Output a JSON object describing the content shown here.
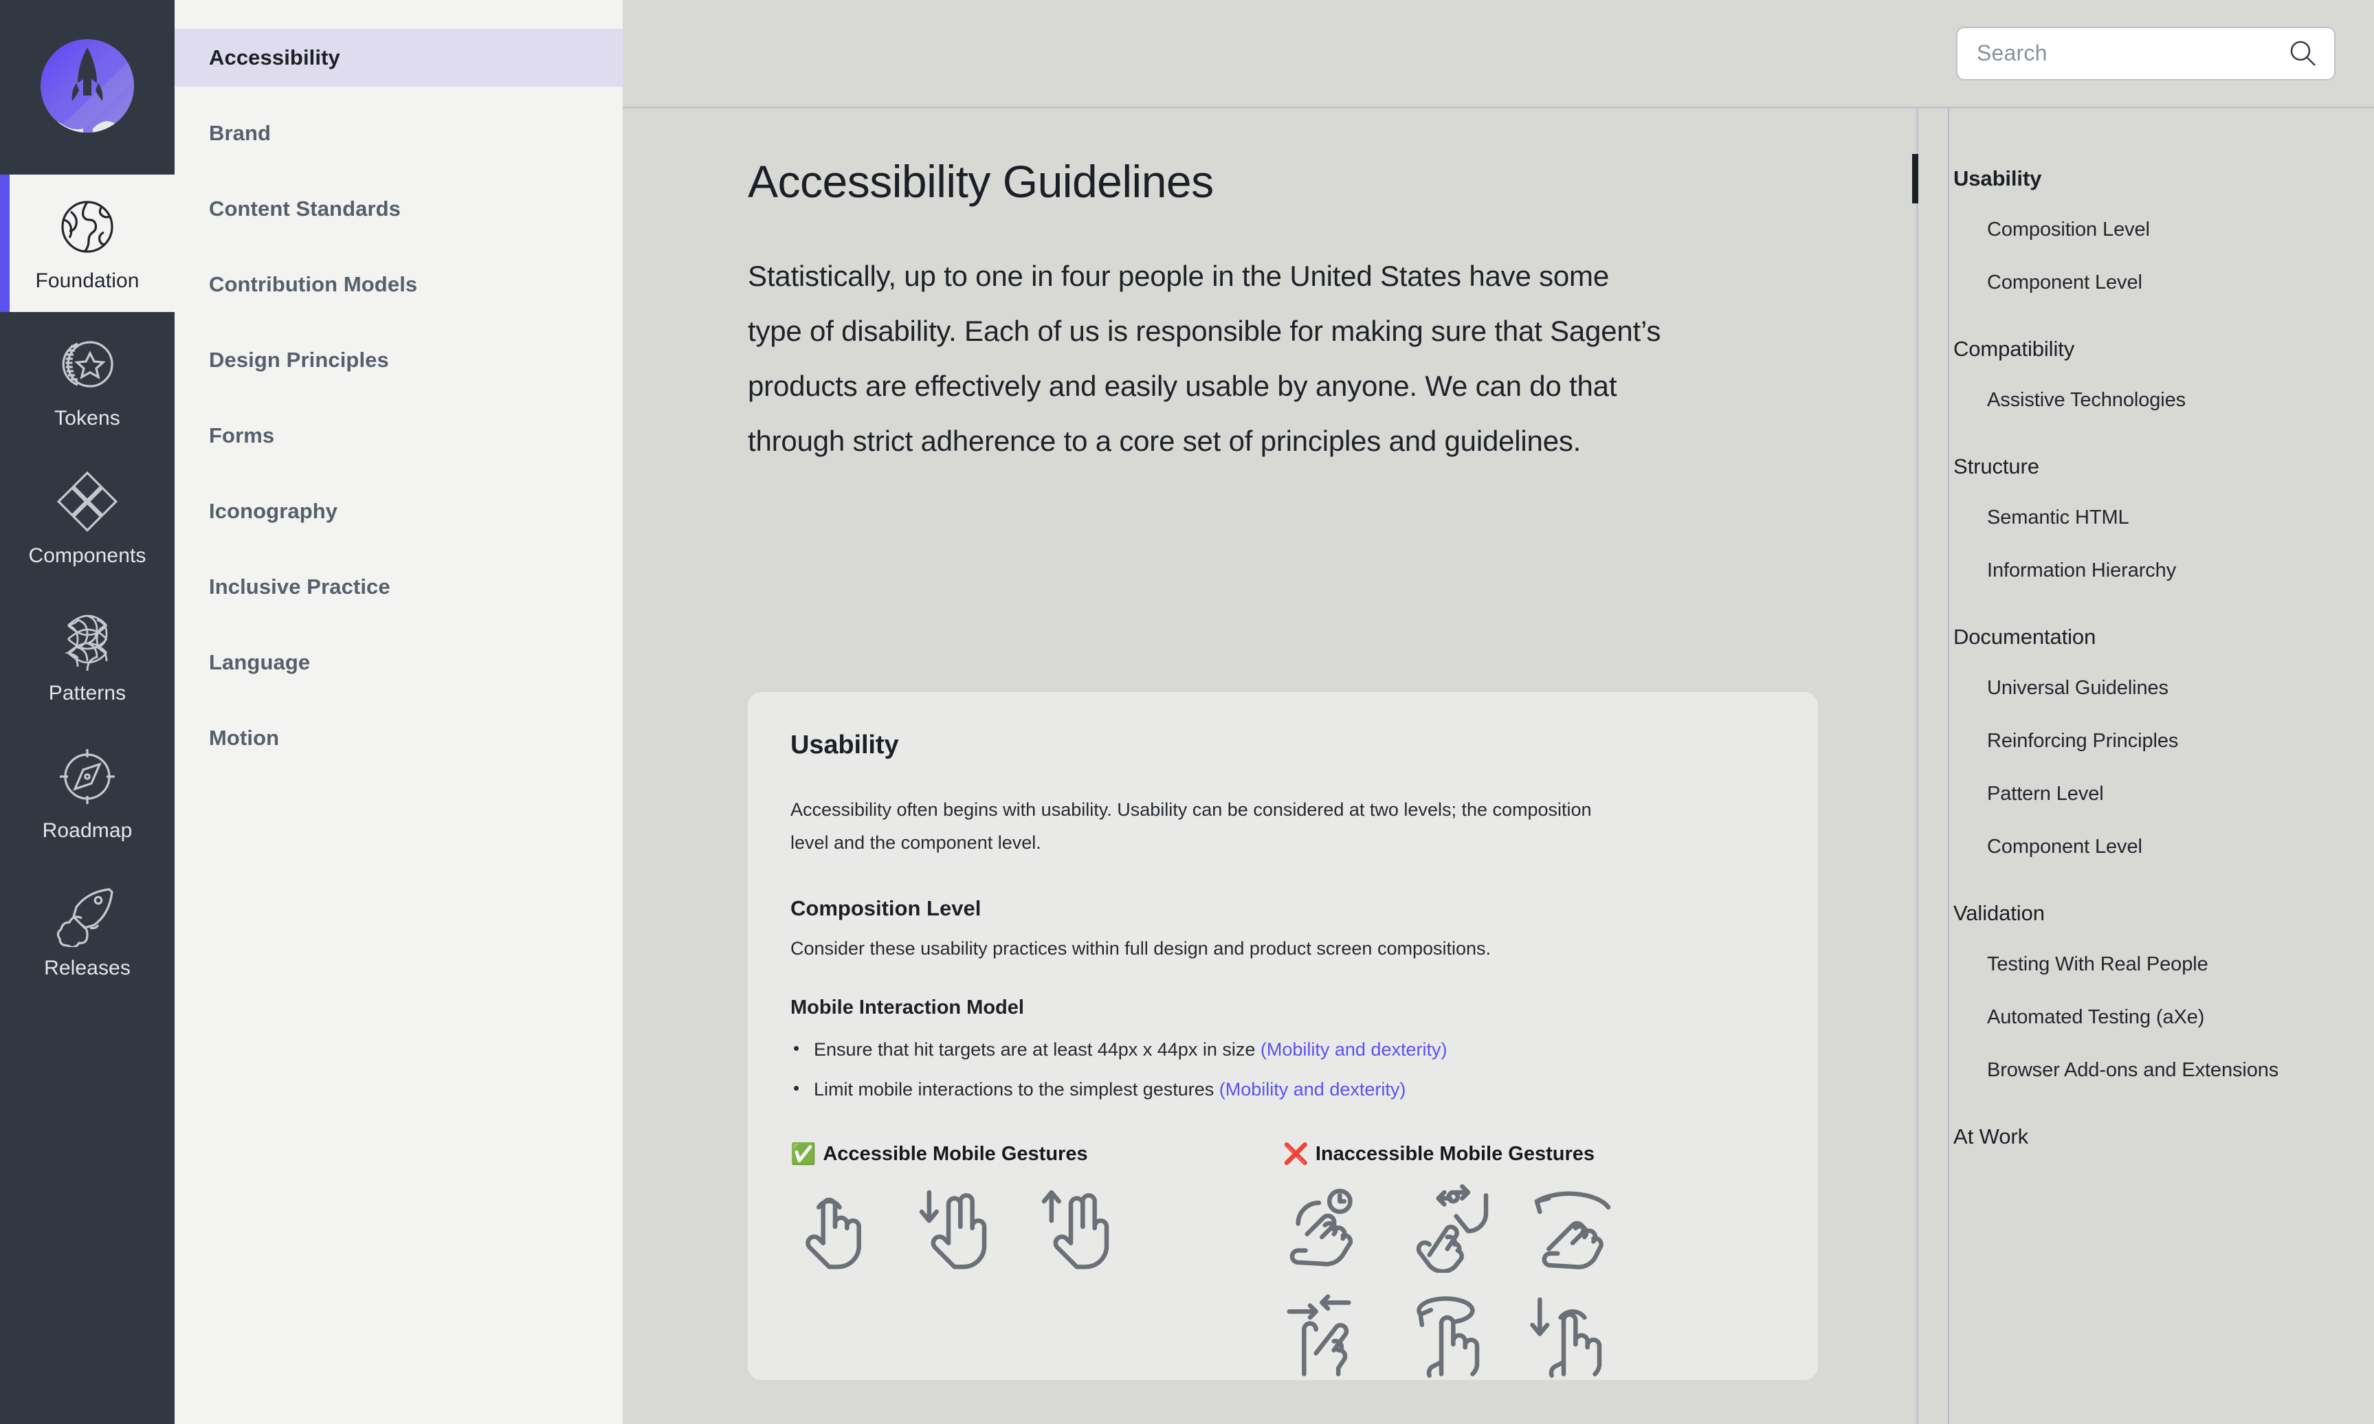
{
  "brand": {
    "logo_icon": "rocket-launch-logo"
  },
  "rail": {
    "items": [
      {
        "label": "Foundation",
        "icon": "globe-icon",
        "active": true
      },
      {
        "label": "Tokens",
        "icon": "coin-star-icon",
        "active": false
      },
      {
        "label": "Components",
        "icon": "four-diamonds-icon",
        "active": false
      },
      {
        "label": "Patterns",
        "icon": "pattern-grid-icon",
        "active": false
      },
      {
        "label": "Roadmap",
        "icon": "compass-icon",
        "active": false
      },
      {
        "label": "Releases",
        "icon": "rocket-icon",
        "active": false
      }
    ]
  },
  "subnav": {
    "items": [
      {
        "label": "Accessibility",
        "active": true
      },
      {
        "label": "Brand",
        "active": false
      },
      {
        "label": "Content Standards",
        "active": false
      },
      {
        "label": "Contribution Models",
        "active": false
      },
      {
        "label": "Design Principles",
        "active": false
      },
      {
        "label": "Forms",
        "active": false
      },
      {
        "label": "Iconography",
        "active": false
      },
      {
        "label": "Inclusive Practice",
        "active": false
      },
      {
        "label": "Language",
        "active": false
      },
      {
        "label": "Motion",
        "active": false
      }
    ]
  },
  "search": {
    "placeholder": "Search",
    "value": "",
    "icon": "search-icon"
  },
  "page": {
    "title": "Accessibility Guidelines",
    "intro": "Statistically, up to one in four people in the United States have some type of disability. Each of us is responsible for making sure that Sagent’s products are effectively and easily usable by anyone. We can do that through strict adherence to a core set of principles and guidelines."
  },
  "card": {
    "heading": "Usability",
    "body": "Accessibility often begins with usability. Usability can be considered at two levels; the composition level and the component level.",
    "composition_heading": "Composition Level",
    "composition_body": "Consider these usability practices within full design and product screen compositions.",
    "mobile_heading": "Mobile Interaction Model",
    "bullets": [
      {
        "text": "Ensure that hit targets are at least 44px x 44px in size ",
        "link": "(Mobility and dexterity)"
      },
      {
        "text": "Limit mobile interactions to the simplest gestures ",
        "link": "(Mobility and dexterity)"
      }
    ],
    "accessible": {
      "emoji": "✅",
      "label": "Accessible Mobile Gestures",
      "icons": [
        "tap-gesture-icon",
        "two-finger-swipe-down-icon",
        "two-finger-swipe-up-icon"
      ]
    },
    "inaccessible": {
      "emoji": "❌",
      "label": "Inaccessible Mobile Gestures",
      "icons": [
        "press-and-hold-icon",
        "pinch-spread-icon",
        "rotate-swipe-icon",
        "two-finger-drag-icon",
        "one-finger-rotate-icon",
        "three-finger-swipe-down-icon"
      ]
    }
  },
  "toc": {
    "groups": [
      {
        "title": "Usability",
        "active": true,
        "items": [
          "Composition Level",
          "Component Level"
        ]
      },
      {
        "title": "Compatibility",
        "active": false,
        "items": [
          "Assistive Technologies"
        ]
      },
      {
        "title": "Structure",
        "active": false,
        "items": [
          "Semantic HTML",
          "Information Hierarchy"
        ]
      },
      {
        "title": "Documentation",
        "active": false,
        "items": [
          "Universal Guidelines",
          "Reinforcing Principles",
          "Pattern Level",
          "Component Level"
        ]
      },
      {
        "title": "Validation",
        "active": false,
        "items": [
          "Testing With Real People",
          "Automated Testing (aXe)",
          "Browser Add-ons and Extensions"
        ]
      },
      {
        "title": "At Work",
        "active": false,
        "items": []
      }
    ]
  },
  "colors": {
    "rail_bg": "#323842",
    "accent": "#5B52F0",
    "subnav_bg": "#F3F3F2",
    "subnav_active_bg": "#DEDCEE",
    "page_bg": "#D8D8D4",
    "card_bg": "#E9E9E7",
    "link": "#5B52F0",
    "error": "#E0242B"
  }
}
